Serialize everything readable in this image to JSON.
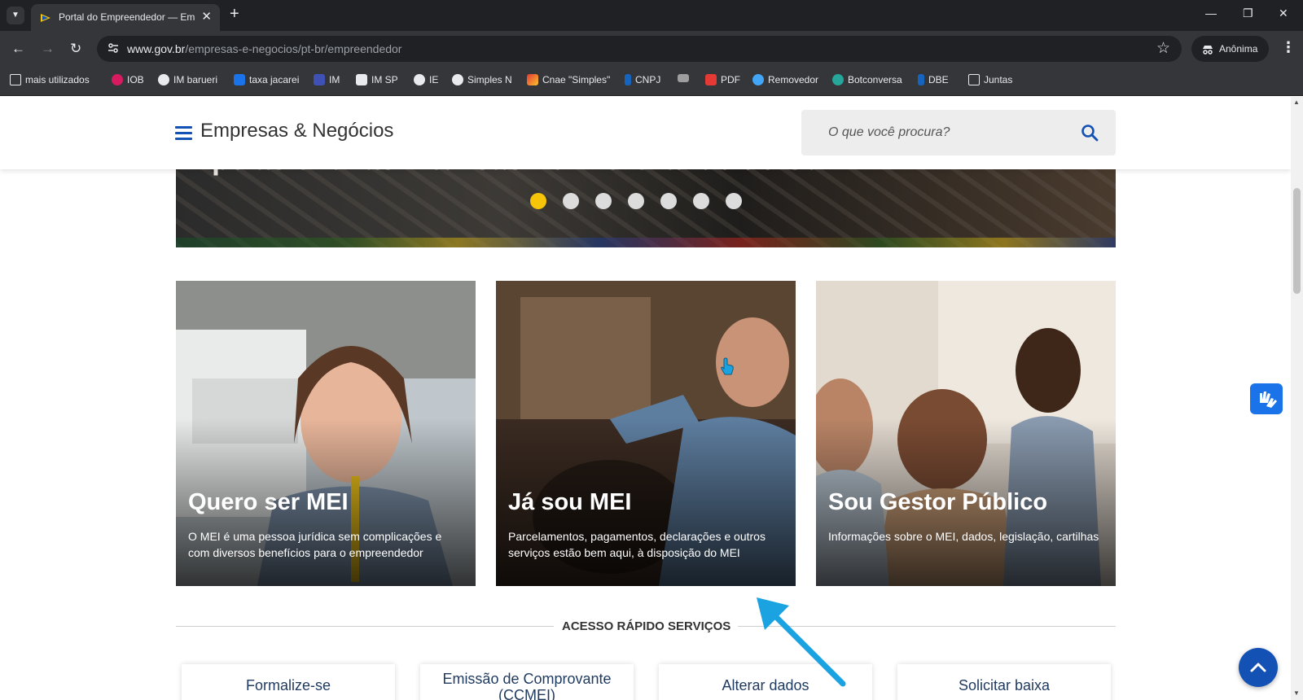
{
  "browser": {
    "tab_title": "Portal do Empreendedor — Em",
    "url_host": "www.gov.br",
    "url_path": "/empresas-e-negocios/pt-br/empreendedor",
    "profile_label": "Anônima",
    "bookmarks": [
      {
        "label": "mais utilizados",
        "icon": "folder-icon"
      },
      {
        "label": "IOB",
        "icon": "iob-icon"
      },
      {
        "label": "IM barueri",
        "icon": "globe-icon"
      },
      {
        "label": "taxa jacarei",
        "icon": "taxa-icon"
      },
      {
        "label": "IM",
        "icon": "iss-icon"
      },
      {
        "label": "IM SP",
        "icon": "doc-icon"
      },
      {
        "label": "IE",
        "icon": "globe-icon"
      },
      {
        "label": "Simples N",
        "icon": "globe-icon"
      },
      {
        "label": "Cnae \"Simples\"",
        "icon": "cnae-icon"
      },
      {
        "label": "CNPJ",
        "icon": "receita-icon"
      },
      {
        "label": "",
        "icon": "flag-icon"
      },
      {
        "label": "PDF",
        "icon": "pdf-icon"
      },
      {
        "label": "Removedor",
        "icon": "removedor-icon"
      },
      {
        "label": "Botconversa",
        "icon": "botconversa-icon"
      },
      {
        "label": "DBE",
        "icon": "receita-icon"
      },
      {
        "label": "Juntas",
        "icon": "folder-icon"
      }
    ]
  },
  "header": {
    "site_title": "Empresas & Negócios",
    "search_placeholder": "O que você procura?"
  },
  "hero": {
    "caption": "pelas chuvas intensas no Rio Grande do Sul",
    "slide_count": 7,
    "active_slide": 1
  },
  "cards": [
    {
      "title": "Quero ser MEI",
      "description": "O MEI é uma pessoa jurídica sem complicações e com diversos benefícios para o empreendedor"
    },
    {
      "title": "Já sou MEI",
      "description": "Parcelamentos, pagamentos, declarações e outros serviços estão bem aqui, à disposição do MEI"
    },
    {
      "title": "Sou Gestor Público",
      "description": "Informações sobre o MEI, dados, legislação, cartilhas"
    }
  ],
  "quick_access": {
    "title": "ACESSO RÁPIDO SERVIÇOS",
    "items": [
      "Formalize-se",
      "Emissão de Comprovante (CCMEI)",
      "Alterar dados",
      "Solicitar baixa"
    ]
  },
  "colors": {
    "gov_blue": "#1351b4",
    "dot_active": "#f6c408",
    "annotation_arrow": "#1aa3e0"
  }
}
